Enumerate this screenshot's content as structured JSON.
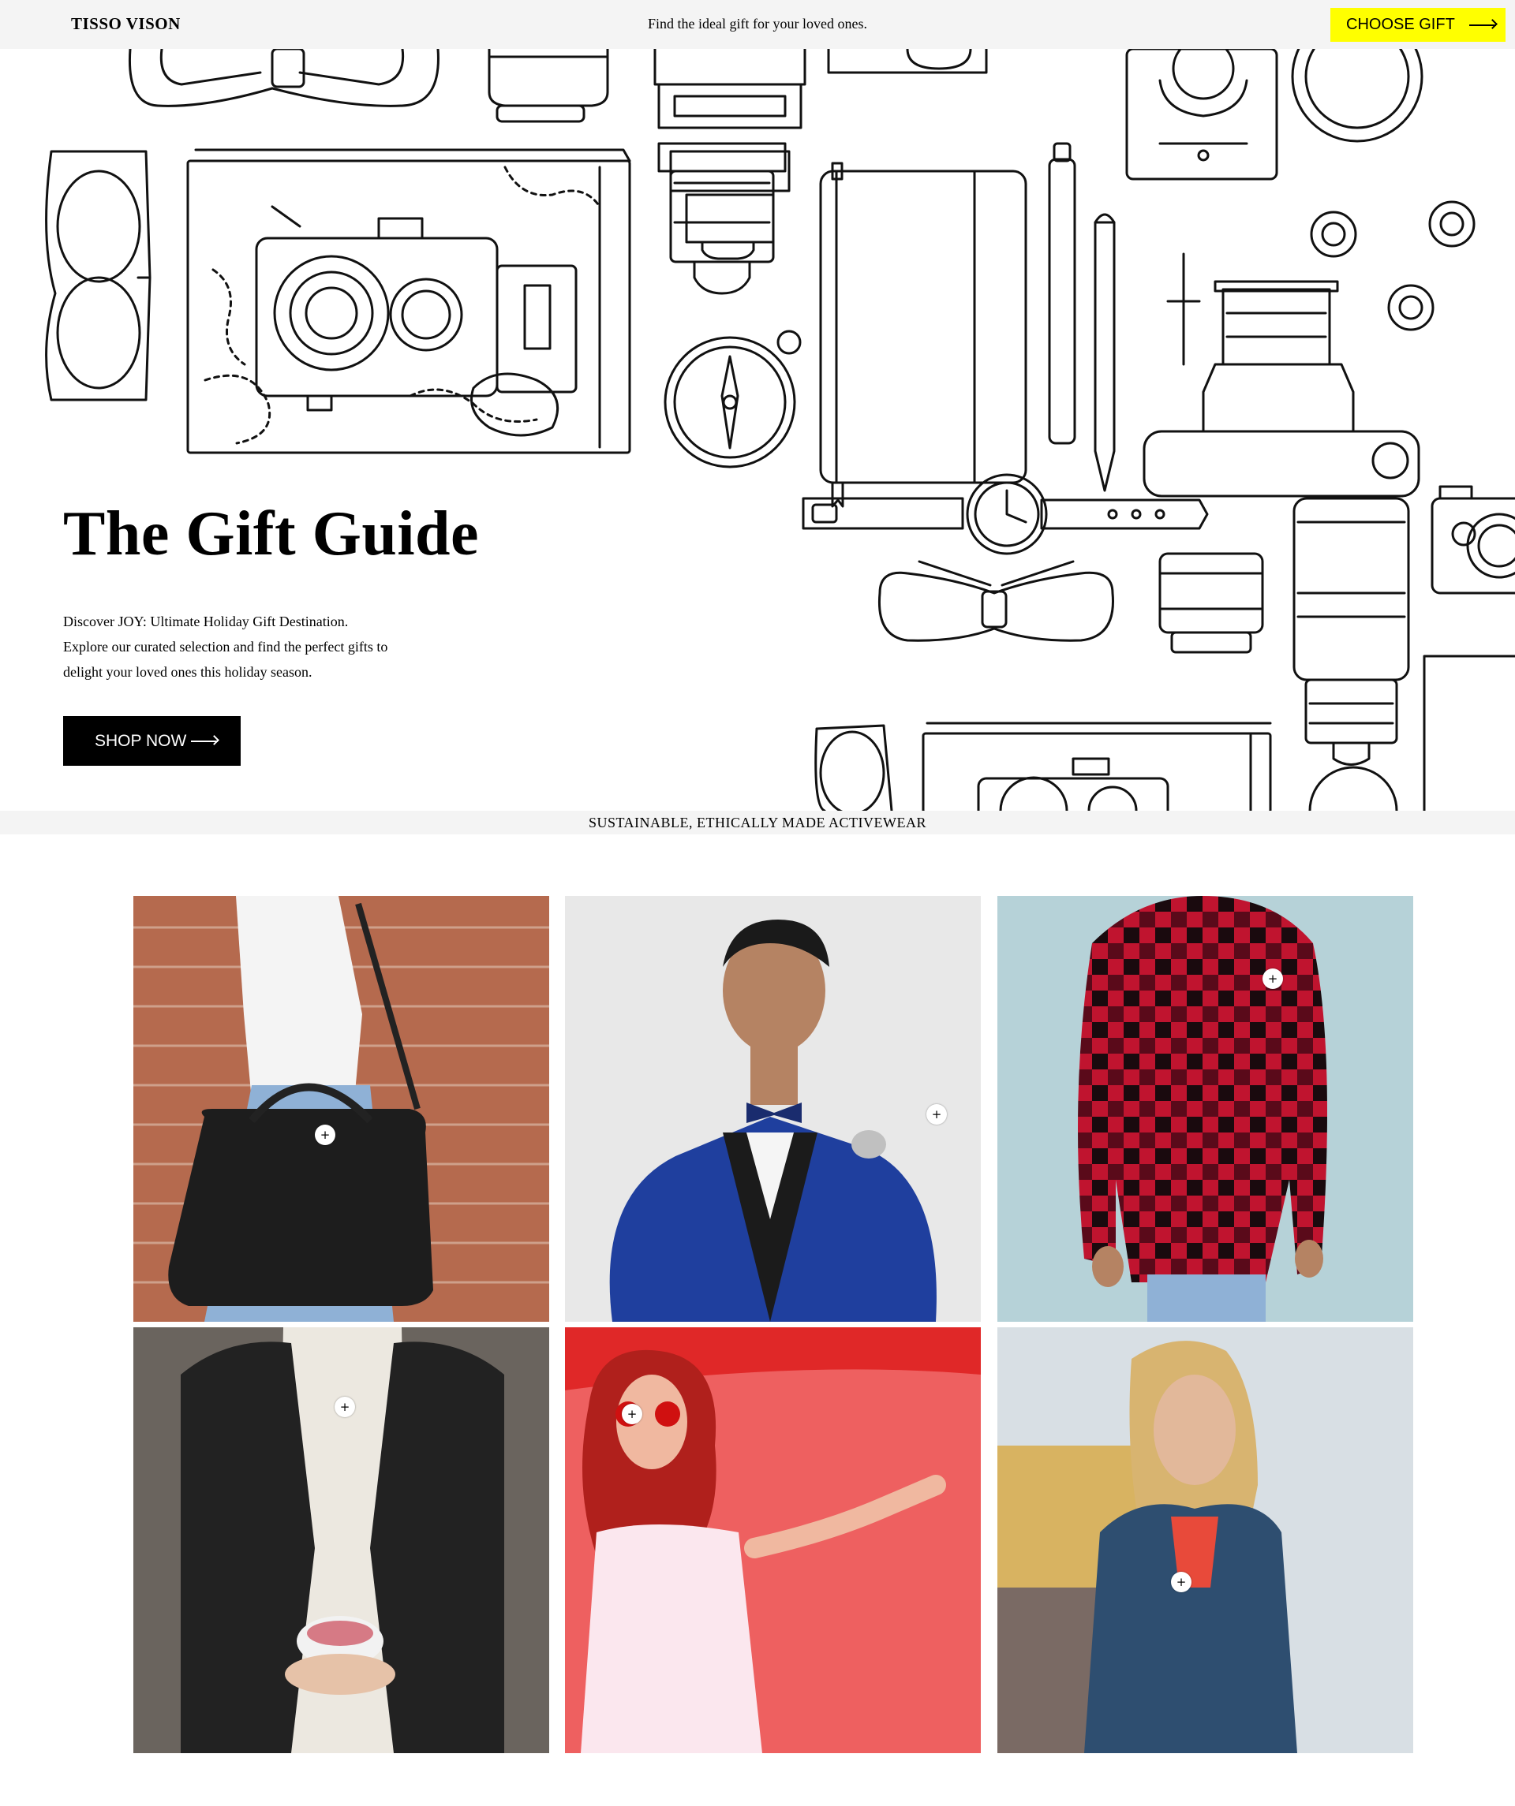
{
  "header": {
    "brand": "TISSO VISON",
    "promo": "Find the ideal gift for your loved ones.",
    "cta_label": "CHOOSE GIFT",
    "cta_color": "#ffff00"
  },
  "hero": {
    "title": "The Gift Guide",
    "description_lines": [
      "Discover JOY: Ultimate Holiday Gift Destination.",
      "Explore our curated selection and find the perfect gifts to",
      "delight your loved ones this holiday season."
    ],
    "button_label": "SHOP NOW",
    "illustration": "line-art gift items: glasses, map, camera, compass, notebook, pen, pencil, watch, bow tie, lenses, tape"
  },
  "strip": {
    "text": "SUSTAINABLE, ETHICALLY MADE ACTIVEWEAR"
  },
  "products": [
    {
      "photo": "woman with black leather handbag against brick wall",
      "hotspot": "+"
    },
    {
      "photo": "man in blue jacket adjusting bow tie",
      "hotspot": "+"
    },
    {
      "photo": "man in red and black plaid flannel shirt",
      "hotspot": "+"
    },
    {
      "photo": "person in black leather jacket holding a cup",
      "hotspot": "+"
    },
    {
      "photo": "woman with red hair and sunglasses on red background",
      "hotspot": "+"
    },
    {
      "photo": "woman in denim jacket at a fair",
      "hotspot": "+"
    }
  ]
}
